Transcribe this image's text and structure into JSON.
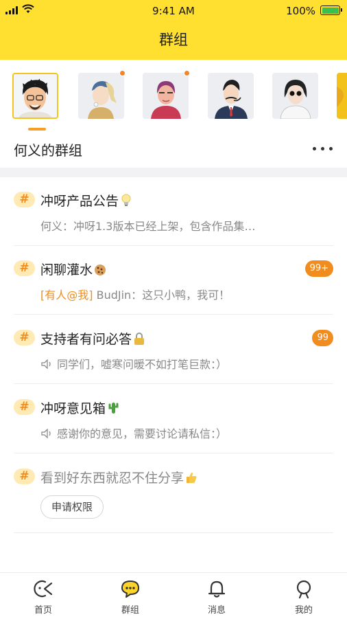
{
  "status_bar": {
    "time": "9:41 AM",
    "battery_percent": "100%"
  },
  "header": {
    "title": "群组"
  },
  "avatars": [
    {
      "name": "avatar-1",
      "selected": true,
      "has_dot": false
    },
    {
      "name": "avatar-2",
      "selected": false,
      "has_dot": true
    },
    {
      "name": "avatar-3",
      "selected": false,
      "has_dot": true
    },
    {
      "name": "avatar-4",
      "selected": false,
      "has_dot": false
    },
    {
      "name": "avatar-5",
      "selected": false,
      "has_dot": false
    }
  ],
  "group_header": {
    "name": "何义的群组",
    "more_icon": "more-dots-icon"
  },
  "groups": [
    {
      "hash": "#",
      "title": "冲呀产品公告",
      "emoji": "lightbulb",
      "subtitle": "何义：冲呀1.3版本已经上架，包含作品集…",
      "badge": ""
    },
    {
      "hash": "#",
      "title": "闲聊灌水",
      "emoji": "cookie",
      "mention": "[有人@我]",
      "subtitle": " BudJin：这只小鸭，我可！",
      "badge": "99+"
    },
    {
      "hash": "#",
      "title": "支持者有问必答",
      "emoji": "lock",
      "subtitle": "同学们，嘘寒问暖不如打笔巨款：）",
      "badge": "99"
    },
    {
      "hash": "#",
      "title": "冲呀意见箱",
      "emoji": "cactus",
      "subtitle": "感谢你的意见，需要讨论请私信：）",
      "badge": ""
    },
    {
      "hash": "#",
      "title": "看到好东西就忍不住分享",
      "emoji": "thumbs-up",
      "button": "申请权限"
    }
  ],
  "tabbar": [
    {
      "label": "首页",
      "icon": "home-icon",
      "active": false
    },
    {
      "label": "群组",
      "icon": "chat-icon",
      "active": true
    },
    {
      "label": "消息",
      "icon": "bell-icon",
      "active": false
    },
    {
      "label": "我的",
      "icon": "profile-icon",
      "active": false
    }
  ],
  "colors": {
    "brand_yellow": "#ffdf2f",
    "accent_orange": "#f08d1e",
    "hash_bg": "#ffeab3"
  }
}
